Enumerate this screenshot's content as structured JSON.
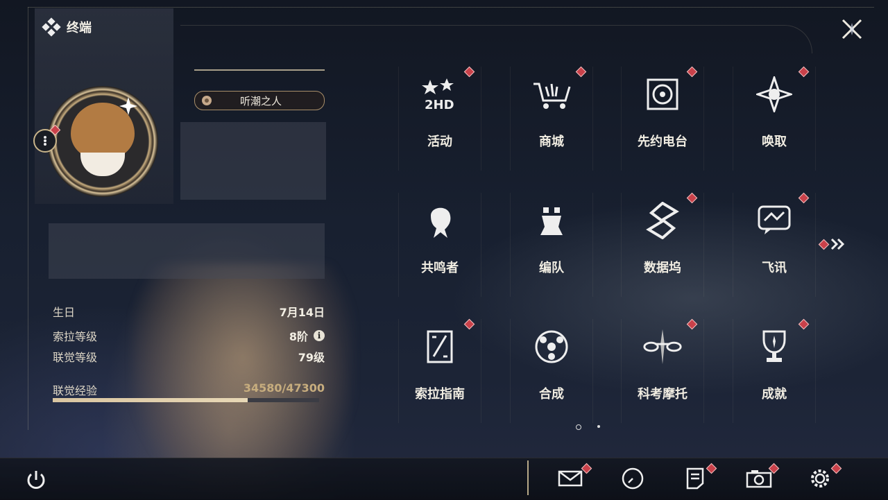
{
  "header": {
    "title": "终端"
  },
  "profile": {
    "title_badge": "听潮之人",
    "birthday_label": "生日",
    "birthday_value": "7月14日",
    "sola_level_label": "索拉等级",
    "sola_level_value": "8阶",
    "union_level_label": "联觉等级",
    "union_level_value": "79级",
    "union_exp_label": "联觉经验",
    "union_exp_value": "34580/47300",
    "union_exp_fraction": 0.731
  },
  "menu": {
    "items": [
      {
        "label": "活动",
        "icon": "events-icon",
        "badge": true
      },
      {
        "label": "商城",
        "icon": "shop-icon",
        "badge": true
      },
      {
        "label": "先约电台",
        "icon": "radio-icon",
        "badge": true
      },
      {
        "label": "唤取",
        "icon": "convene-icon",
        "badge": true
      },
      {
        "label": "共鸣者",
        "icon": "resonator-icon",
        "badge": false
      },
      {
        "label": "编队",
        "icon": "team-icon",
        "badge": false
      },
      {
        "label": "数据坞",
        "icon": "databank-icon",
        "badge": true
      },
      {
        "label": "飞讯",
        "icon": "messages-icon",
        "badge": true
      },
      {
        "label": "索拉指南",
        "icon": "guidebook-icon",
        "badge": true
      },
      {
        "label": "合成",
        "icon": "synthesis-icon",
        "badge": false
      },
      {
        "label": "科考摩托",
        "icon": "motorcycle-icon",
        "badge": true
      },
      {
        "label": "成就",
        "icon": "achievement-icon",
        "badge": true
      }
    ]
  },
  "pager": {
    "current_page": 1,
    "total_pages": 2
  },
  "bottom_bar": {
    "buttons": [
      "mail-icon",
      "clock-icon",
      "notice-icon",
      "camera-icon",
      "settings-icon"
    ]
  },
  "colors": {
    "accent_gold": "#c7ad7e",
    "badge_red": "#c9414a",
    "text": "#f1ede2"
  }
}
